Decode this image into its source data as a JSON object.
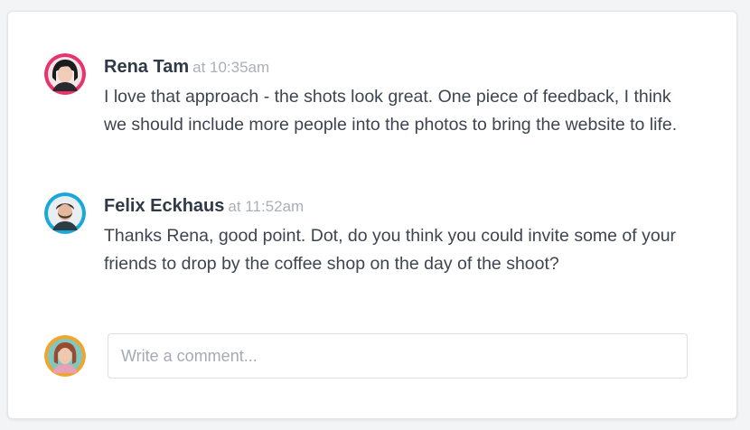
{
  "comments": [
    {
      "author": "Rena Tam",
      "time_label": "at 10:35am",
      "text": "I love that approach - the shots look great. One piece of feedback, I think we should include more people into the photos to bring the website to life.",
      "avatar_icon": "user-avatar-rena",
      "avatar_ring": "#e8336d"
    },
    {
      "author": "Felix Eckhaus",
      "time_label": "at 11:52am",
      "text": "Thanks Rena, good point. Dot, do you think you could invite some of your friends to drop by the coffee shop on the day of the shoot?",
      "avatar_icon": "user-avatar-felix",
      "avatar_ring": "#1aa7d9"
    }
  ],
  "composer": {
    "placeholder": "Write a comment...",
    "value": "",
    "avatar_icon": "current-user-avatar",
    "avatar_ring": "#f0a531"
  }
}
